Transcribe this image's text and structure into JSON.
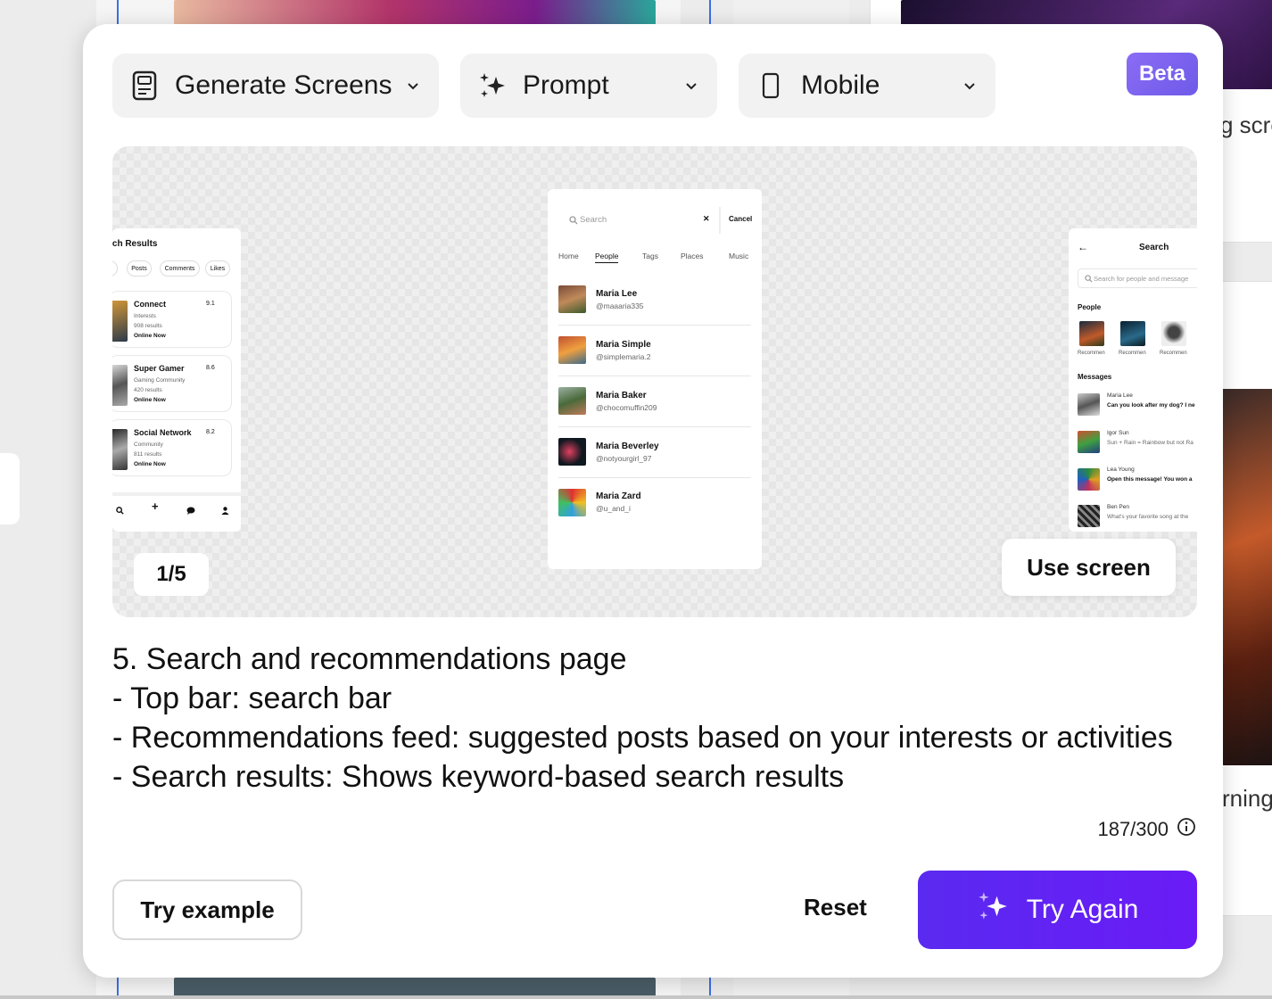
{
  "toolbar": {
    "mode": {
      "label": "Generate Screens",
      "icon": "screens-icon"
    },
    "input_type": {
      "label": "Prompt",
      "icon": "sparkle-icon"
    },
    "device": {
      "label": "Mobile",
      "icon": "phone-icon"
    },
    "badge": "Beta"
  },
  "background": {
    "snippet_1": "g scre",
    "snippet_2": "rning"
  },
  "preview": {
    "counter": "1/5",
    "use_screen_label": "Use screen",
    "left_screen": {
      "title": "rch Results",
      "pills": [
        "Posts",
        "Comments",
        "Likes"
      ],
      "cards": [
        {
          "name": "Connect",
          "sub": "Interests",
          "count": "908 results",
          "status": "Online Now",
          "score": "9.1"
        },
        {
          "name": "Super Gamer",
          "sub": "Gaming Community",
          "count": "420 results",
          "status": "Online Now",
          "score": "8.6"
        },
        {
          "name": "Social Network",
          "sub": "Community",
          "count": "811 results",
          "status": "Online Now",
          "score": "8.2"
        }
      ],
      "nav_plus": "+"
    },
    "center_screen": {
      "search_placeholder": "Search",
      "clear": "✕",
      "cancel": "Cancel",
      "tabs": [
        "Home",
        "People",
        "Tags",
        "Places",
        "Music"
      ],
      "people": [
        {
          "name": "Maria Lee",
          "handle": "@maaaria335"
        },
        {
          "name": "Maria Simple",
          "handle": "@simplemaria.2"
        },
        {
          "name": "Maria Baker",
          "handle": "@chocomuffin209"
        },
        {
          "name": "Maria Beverley",
          "handle": "@notyourgirl_97"
        },
        {
          "name": "Maria Zard",
          "handle": "@u_and_i"
        }
      ]
    },
    "right_screen": {
      "back": "←",
      "title": "Search",
      "search_placeholder": "Search for people and message",
      "people_heading": "People",
      "people": [
        "Recommen",
        "Recommen",
        "Recommen"
      ],
      "messages_heading": "Messages",
      "messages": [
        {
          "name": "Maria Lee",
          "text": "Can you look after my dog? I ne"
        },
        {
          "name": "Igor Sun",
          "text": "Sun + Rain = Rainbow but not Ra"
        },
        {
          "name": "Lea Young",
          "text": "Open this message! You won a"
        },
        {
          "name": "Ben Pen",
          "text": "What's your favorite song at the"
        }
      ]
    }
  },
  "description": [
    "5. Search and recommendations page",
    "- Top bar: search bar",
    "- Recommendations feed: suggested posts based on your interests or activities",
    "- Search results: Shows keyword-based search results"
  ],
  "char_count": "187/300",
  "actions": {
    "try_example": "Try example",
    "reset": "Reset",
    "try_again": "Try Again"
  }
}
